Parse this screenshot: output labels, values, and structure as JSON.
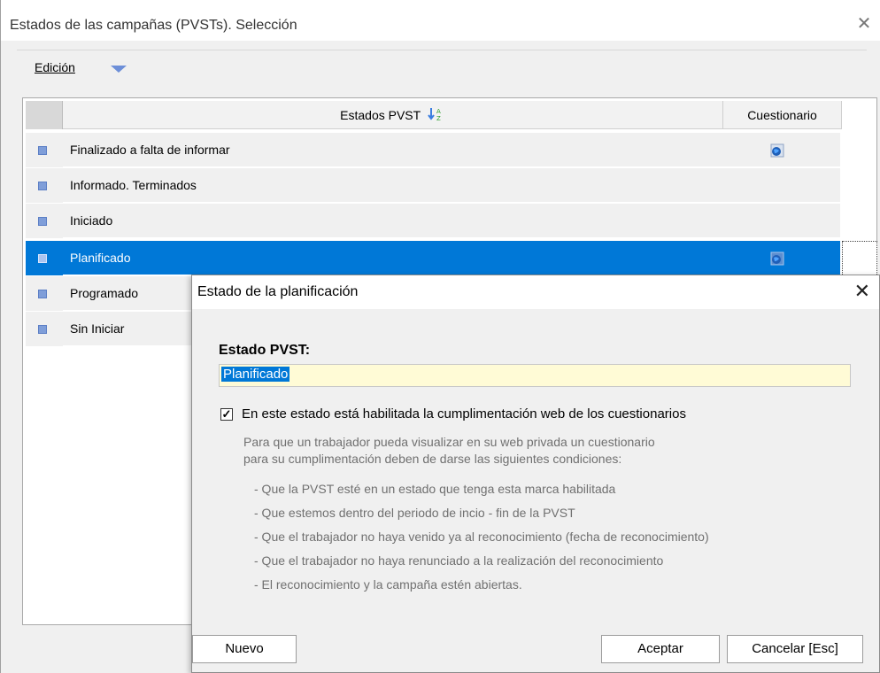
{
  "outer_window": {
    "title": "Estados de las campañas (PVSTs). Selección",
    "close_glyph": "✕",
    "menu_edicion": "Edición"
  },
  "grid": {
    "header_estados": "Estados PVST",
    "header_cuestionario": "Cuestionario",
    "rows": [
      {
        "name": "Finalizado a falta de informar",
        "has_questionnaire": true
      },
      {
        "name": "Informado. Terminados",
        "has_questionnaire": false
      },
      {
        "name": "Iniciado",
        "has_questionnaire": false
      },
      {
        "name": "Planificado",
        "has_questionnaire": true,
        "selected": true
      },
      {
        "name": "Programado",
        "has_questionnaire": false
      },
      {
        "name": "Sin Iniciar",
        "has_questionnaire": false
      }
    ]
  },
  "dialog": {
    "title": "Estado de la planificación",
    "close_glyph": "✕",
    "field_label": "Estado PVST:",
    "field_value": "Planificado",
    "checkbox_label": "En este estado está habilitada la cumplimentación web de los  cuestionarios",
    "checkbox_checked": true,
    "help_lines": [
      "Para que un trabajador pueda visualizar en su web privada un cuestionario",
      "para su cumplimentación deben de darse las siguientes condiciones:"
    ],
    "conditions": [
      "- Que la PVST esté en un estado que tenga esta marca habilitada",
      "- Que estemos dentro del periodo de incio - fin de la PVST",
      "- Que el trabajador no haya venido ya al reconocimiento (fecha de reconocimiento)",
      "- Que el trabajador no haya renunciado a la realización del reconocimiento",
      "- El reconocimiento y la campaña estén abiertas."
    ],
    "buttons": {
      "nuevo": "Nuevo",
      "aceptar": "Aceptar",
      "cancelar": "Cancelar  [Esc]"
    }
  },
  "colors": {
    "selection": "#0078d7",
    "input_bg": "#fffbd6",
    "marker": "#7f9ed9"
  }
}
